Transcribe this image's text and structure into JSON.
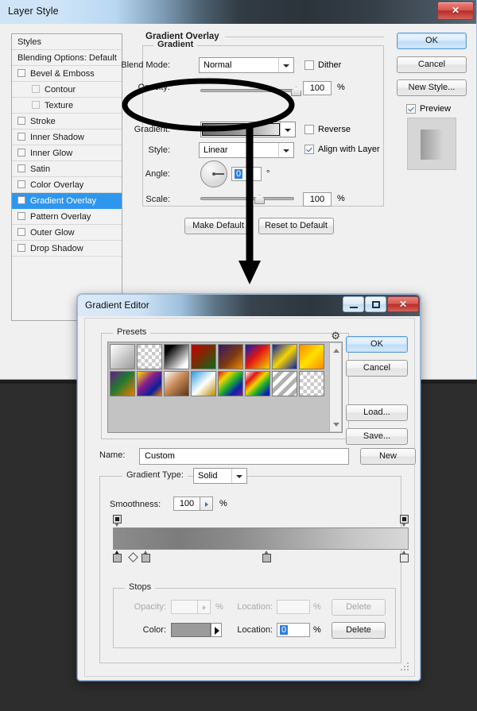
{
  "desktop": {
    "background_color": "#2d2d2d"
  },
  "layer_style_window": {
    "title": "Layer Style",
    "close_label": "✕",
    "styles_list": {
      "header": "Styles",
      "items": [
        {
          "label": "Blending Options: Default",
          "checkbox": "none",
          "indent": 0,
          "selected": false
        },
        {
          "label": "Bevel & Emboss",
          "checkbox": "off",
          "indent": 0,
          "selected": false
        },
        {
          "label": "Contour",
          "checkbox": "off-dim",
          "indent": 1,
          "selected": false
        },
        {
          "label": "Texture",
          "checkbox": "off-dim",
          "indent": 1,
          "selected": false
        },
        {
          "label": "Stroke",
          "checkbox": "off",
          "indent": 0,
          "selected": false
        },
        {
          "label": "Inner Shadow",
          "checkbox": "off",
          "indent": 0,
          "selected": false
        },
        {
          "label": "Inner Glow",
          "checkbox": "off",
          "indent": 0,
          "selected": false
        },
        {
          "label": "Satin",
          "checkbox": "off",
          "indent": 0,
          "selected": false
        },
        {
          "label": "Color Overlay",
          "checkbox": "off",
          "indent": 0,
          "selected": false
        },
        {
          "label": "Gradient Overlay",
          "checkbox": "on",
          "indent": 0,
          "selected": true
        },
        {
          "label": "Pattern Overlay",
          "checkbox": "off",
          "indent": 0,
          "selected": false
        },
        {
          "label": "Outer Glow",
          "checkbox": "off",
          "indent": 0,
          "selected": false
        },
        {
          "label": "Drop Shadow",
          "checkbox": "off",
          "indent": 0,
          "selected": false
        }
      ]
    },
    "gradient_overlay": {
      "section_title": "Gradient Overlay",
      "group_legend": "Gradient",
      "blend_mode_label": "Blend Mode:",
      "blend_mode_value": "Normal",
      "dither_label": "Dither",
      "dither_checked": false,
      "opacity_label": "Opacity:",
      "opacity_value": "100",
      "opacity_unit": "%",
      "gradient_label": "Gradient:",
      "reverse_label": "Reverse",
      "reverse_checked": false,
      "style_label": "Style:",
      "style_value": "Linear",
      "align_label": "Align with Layer",
      "align_checked": true,
      "angle_label": "Angle:",
      "angle_value": "0",
      "angle_unit": "°",
      "scale_label": "Scale:",
      "scale_value": "100",
      "scale_unit": "%",
      "make_default_label": "Make Default",
      "reset_default_label": "Reset to Default"
    },
    "buttons": {
      "ok": "OK",
      "cancel": "Cancel",
      "new_style": "New Style...",
      "preview_label": "Preview",
      "preview_checked": true
    }
  },
  "gradient_editor": {
    "title": "Gradient Editor",
    "window_buttons": {
      "minimize": "minimize-icon",
      "maximize": "maximize-icon",
      "close": "✕"
    },
    "presets": {
      "legend": "Presets",
      "gear_icon": "⚙",
      "swatches": [
        "linear-gradient(to bottom right,#ffffff,#9a9a9a)",
        "repeating-conic-gradient(#ffffff 0% 25%, #c9c9c9 0% 50%) 0 0/9px 9px",
        "linear-gradient(to bottom right,#000000,#ffffff)",
        "linear-gradient(135deg,#c90000 0%,#8a2a00 40%,#0a6b1e 100%)",
        "linear-gradient(135deg,#3a1667 0%,#8a3a12 55%,#f08a00 100%)",
        "linear-gradient(135deg,#0d1fb0 0%,#e01414 45%,#f5d400 100%)",
        "linear-gradient(135deg,#0d1fb0 0%,#f5d400 50%,#0d1fb0 100%)",
        "linear-gradient(135deg,#ff8a00 0%,#ffe000 50%,#ff8a00 100%)",
        "linear-gradient(135deg,#6a1b8a 0%,#1f7a2e 45%,#f07a00 100%)",
        "linear-gradient(135deg,#ffe000 0%,#8a1f8a 40%,#0a1f9a 75%,#f07a00 100%)",
        "linear-gradient(135deg,#ffffff 0%,#c98b5a 45%,#5a3516 100%)",
        "linear-gradient(135deg,#2e9bdc 0%,#ffffff 50%,#b88a00 100%)",
        "linear-gradient(135deg,#e01414,#f5d400,#1fb02e,#0d1fb0,#8a1b8a)",
        "linear-gradient(135deg,#e01414,#f5d400,#1fb02e,#0d1fb0)",
        "repeating-linear-gradient(135deg,#ffffff 0 6px,#b0b0b0 6px 12px)",
        "repeating-conic-gradient(#ffffff 0% 25%, #c9c9c9 0% 50%) 0 0/9px 9px"
      ]
    },
    "buttons": {
      "ok": "OK",
      "cancel": "Cancel",
      "load": "Load...",
      "save": "Save...",
      "new": "New"
    },
    "name_label": "Name:",
    "name_value": "Custom",
    "gradient_type": {
      "legend": "Gradient Type:",
      "value": "Solid",
      "smoothness_label": "Smoothness:",
      "smoothness_value": "100",
      "smoothness_unit": "%"
    },
    "gradient_bar": {
      "css": "linear-gradient(to right,#8c8c8c 0%,#7c7c7c 22%,#8c8c8c 42%,#a8a8a8 62%,#c6c6c6 82%,#d8d8d8 100%)",
      "opacity_stops_pct": [
        0,
        100
      ],
      "color_stops_pct": [
        0,
        10,
        50,
        100
      ],
      "midpoint_pct": 4
    },
    "stops": {
      "legend": "Stops",
      "opacity_label": "Opacity:",
      "opacity_value": "",
      "opacity_unit": "%",
      "opacity_location_label": "Location:",
      "opacity_location_value": "",
      "opacity_location_unit": "%",
      "opacity_delete_label": "Delete",
      "color_label": "Color:",
      "color_swatch": "#9b9b9b",
      "color_location_label": "Location:",
      "color_location_value": "0",
      "color_location_unit": "%",
      "color_delete_label": "Delete"
    }
  },
  "annotation": {
    "ellipse_target": "gradient-swatch-dropdown",
    "arrow_points_to": "gradient-editor-dialog",
    "stroke_color": "#000000"
  }
}
